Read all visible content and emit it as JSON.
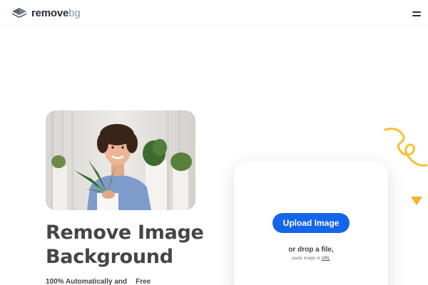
{
  "brand": {
    "name_bold": "remove",
    "name_light": "bg"
  },
  "hero": {
    "headline_line1": "Remove Image",
    "headline_line2": "Background",
    "subline": "100% Automatically and",
    "badge": "Free"
  },
  "upload": {
    "button_label": "Upload Image",
    "drop_text": "or drop a file,",
    "paste_prefix": "paste image or",
    "url_link": "URL"
  },
  "icons": {
    "logo": "stacked-layers-icon",
    "menu": "hamburger-menu-icon"
  },
  "colors": {
    "accent": "#1565e9",
    "highlight": "#ffc43d",
    "text": "#454545"
  }
}
